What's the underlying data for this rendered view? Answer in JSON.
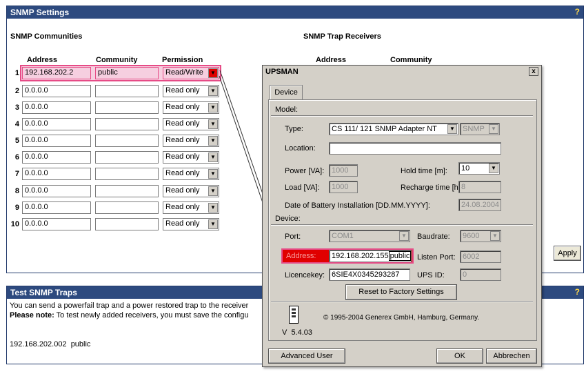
{
  "snmp_panel": {
    "title": "SNMP Settings",
    "help": "?",
    "communities_title": "SNMP Communities",
    "trap_title": "SNMP Trap Receivers",
    "col_address": "Address",
    "col_community": "Community",
    "col_permission": "Permission",
    "trap_col_address": "Address",
    "trap_col_community": "Community",
    "apply_label": "Apply",
    "rows": [
      {
        "num": "1",
        "address": "192.168.202.2",
        "community": "public",
        "permission": "Read/Write"
      },
      {
        "num": "2",
        "address": "0.0.0.0",
        "community": "",
        "permission": "Read only"
      },
      {
        "num": "3",
        "address": "0.0.0.0",
        "community": "",
        "permission": "Read only"
      },
      {
        "num": "4",
        "address": "0.0.0.0",
        "community": "",
        "permission": "Read only"
      },
      {
        "num": "5",
        "address": "0.0.0.0",
        "community": "",
        "permission": "Read only"
      },
      {
        "num": "6",
        "address": "0.0.0.0",
        "community": "",
        "permission": "Read only"
      },
      {
        "num": "7",
        "address": "0.0.0.0",
        "community": "",
        "permission": "Read only"
      },
      {
        "num": "8",
        "address": "0.0.0.0",
        "community": "",
        "permission": "Read only"
      },
      {
        "num": "9",
        "address": "0.0.0.0",
        "community": "",
        "permission": "Read only"
      },
      {
        "num": "10",
        "address": "0.0.0.0",
        "community": "",
        "permission": "Read only"
      }
    ]
  },
  "test_panel": {
    "title": "Test SNMP Traps",
    "help": "?",
    "line1": "You can send a powerfail trap and a power restored trap to the receiver",
    "note_label": "Please note:",
    "line2": " To test newly added receivers, you must save the configu",
    "receiver": "192.168.202.002  public"
  },
  "dialog": {
    "title": "UPSMAN",
    "close": "x",
    "tab": "Device",
    "model_label": "Model:",
    "type_label": "Type:",
    "type_value": "CS 111/ 121 SNMP Adapter NT",
    "protocol_value": "SNMP",
    "location_label": "Location:",
    "location_value": "",
    "power_label": "Power [VA]:",
    "power_value": "1000",
    "hold_label": "Hold time [m]:",
    "hold_value": "10",
    "load_label": "Load [VA]:",
    "load_value": "1000",
    "recharge_label": "Recharge time [h]:",
    "recharge_value": "8",
    "battery_label": "Date of Battery Installation [DD.MM.YYYY]:",
    "battery_value": "24.08.2004",
    "device_label": "Device:",
    "port_label": "Port:",
    "port_value": "COM1",
    "baud_label": "Baudrate:",
    "baud_value": "9600",
    "address_label": "Address:",
    "address_value": "192.168.202.155",
    "address_overlay": "public",
    "listen_label": "Listen Port:",
    "listen_value": "6002",
    "licence_label": "Licencekey:",
    "licence_value": "6SIE4X0345293287",
    "ups_id_label": "UPS ID:",
    "ups_id_value": "0",
    "reset_label": "Reset to Factory Settings",
    "copyright": "© 1995-2004 Generex GmbH, Hamburg, Germany.",
    "version": "V  5.4.03",
    "advanced_label": "Advanced User",
    "ok_label": "OK",
    "cancel_label": "Abbrechen"
  },
  "colors": {
    "header_bg": "#2d4a7f",
    "highlight": "#e64b86",
    "address_highlight": "#e00000"
  }
}
